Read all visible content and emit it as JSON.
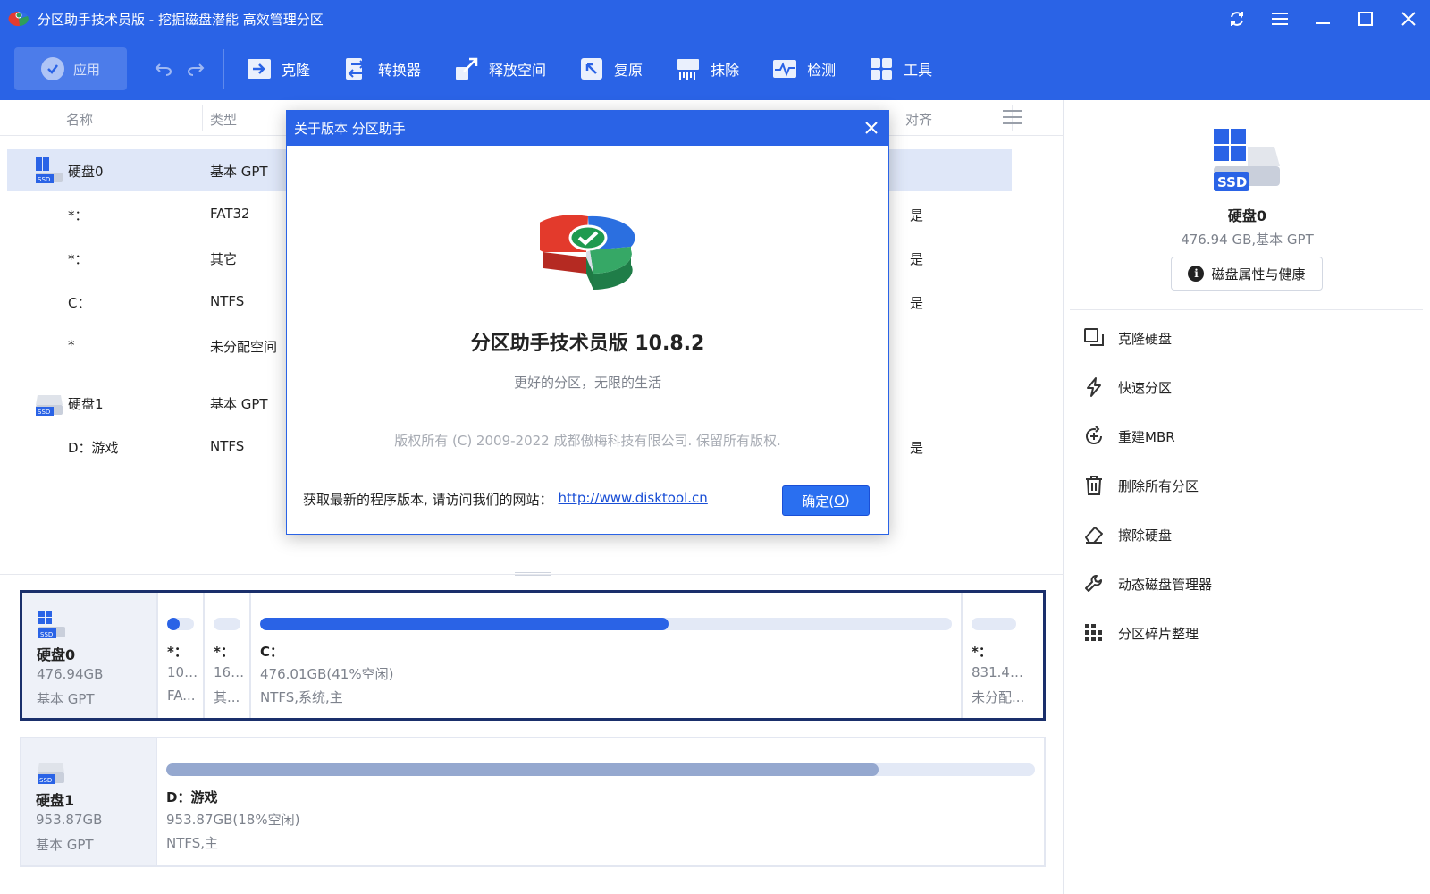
{
  "window": {
    "title": "分区助手技术员版 - 挖掘磁盘潜能 高效管理分区"
  },
  "toolbar": {
    "apply_label": "应用",
    "tools": [
      {
        "label": "克隆",
        "icon": "clone-icon"
      },
      {
        "label": "转换器",
        "icon": "converter-icon"
      },
      {
        "label": "释放空间",
        "icon": "free-space-icon"
      },
      {
        "label": "复原",
        "icon": "restore-icon"
      },
      {
        "label": "抹除",
        "icon": "wipe-icon"
      },
      {
        "label": "检测",
        "icon": "check-icon"
      },
      {
        "label": "工具",
        "icon": "tools-icon"
      }
    ]
  },
  "table": {
    "headers": {
      "name": "名称",
      "type": "类型",
      "align": "对齐"
    },
    "rows": [
      {
        "name": "硬盘0",
        "type": "基本 GPT",
        "align": "",
        "is_disk": true
      },
      {
        "name": "*：",
        "type": "FAT32",
        "align": "是",
        "is_disk": false
      },
      {
        "name": "*：",
        "type": "其它",
        "align": "是",
        "is_disk": false
      },
      {
        "name": "C：",
        "type": "NTFS",
        "align": "是",
        "is_disk": false
      },
      {
        "name": "*",
        "type": "未分配空间",
        "align": "",
        "is_disk": false
      },
      {
        "name": "硬盘1",
        "type": "基本 GPT",
        "align": "",
        "is_disk": true
      },
      {
        "name": "D：游戏",
        "type": "NTFS",
        "align": "是",
        "is_disk": false
      }
    ]
  },
  "disk_map": [
    {
      "name": "硬盘0",
      "size": "476.94GB",
      "type": "基本 GPT",
      "partitions": [
        {
          "name": "*：",
          "line1": "100...",
          "line2": "FA...",
          "used_fraction": 0.45
        },
        {
          "name": "*：",
          "line1": "16....",
          "line2": "其...",
          "used_fraction": 0.0
        },
        {
          "name": "C：",
          "line1": "476.01GB(41%空闲)",
          "line2": "NTFS,系统,主",
          "used_fraction": 0.59
        },
        {
          "name": "*：",
          "line1": "831.44...",
          "line2": "未分配...",
          "used_fraction": 0.0
        }
      ]
    },
    {
      "name": "硬盘1",
      "size": "953.87GB",
      "type": "基本 GPT",
      "partitions": [
        {
          "name": "D：游戏",
          "line1": "953.87GB(18%空闲)",
          "line2": "NTFS,主",
          "used_fraction": 0.82
        }
      ]
    }
  ],
  "right_panel": {
    "disk_name": "硬盘0",
    "disk_info": "476.94 GB,基本 GPT",
    "props_button": "磁盘属性与健康",
    "actions": [
      {
        "label": "克隆硬盘",
        "icon": "clone-disk-icon"
      },
      {
        "label": "快速分区",
        "icon": "lightning-icon"
      },
      {
        "label": "重建MBR",
        "icon": "rebuild-mbr-icon"
      },
      {
        "label": "删除所有分区",
        "icon": "trash-icon"
      },
      {
        "label": "擦除硬盘",
        "icon": "eraser-icon"
      },
      {
        "label": "动态磁盘管理器",
        "icon": "wrench-icon"
      },
      {
        "label": "分区碎片整理",
        "icon": "defrag-icon"
      }
    ]
  },
  "dialog": {
    "title": "关于版本 分区助手",
    "product": "分区助手技术员版 10.8.2",
    "slogan": "更好的分区，无限的生活",
    "copyright": "版权所有 (C) 2009-2022 成都傲梅科技有限公司. 保留所有版权.",
    "visit_text": "获取最新的程序版本, 请访问我们的网站：",
    "link": "http://www.disktool.cn",
    "ok_label": "确定(",
    "ok_key": "O",
    "ok_close": ")"
  },
  "colors": {
    "accent": "#2a63e6",
    "selected_row": "#dfe7f8",
    "bar_fill": "#2a63e6",
    "bar_fill_disk1": "#95a8cf"
  }
}
